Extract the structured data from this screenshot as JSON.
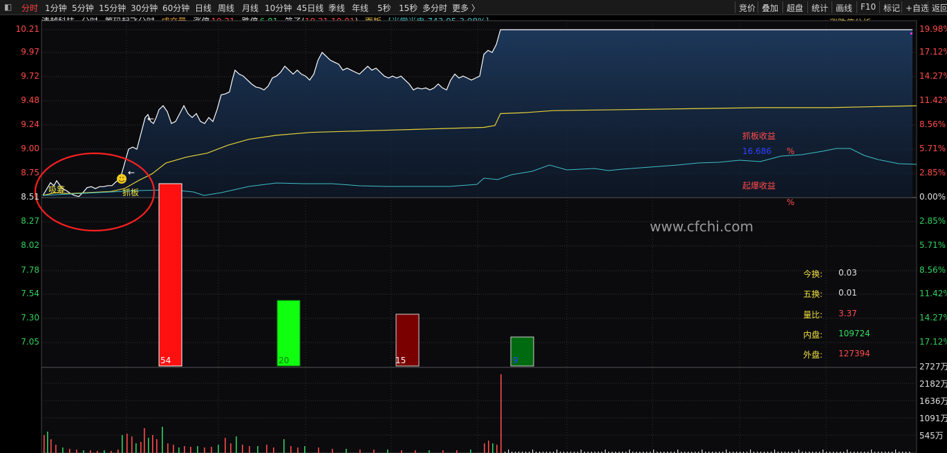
{
  "topbar": {
    "tabs": [
      "分时",
      "1分钟",
      "5分钟",
      "15分钟",
      "30分钟",
      "60分钟",
      "日线",
      "周线",
      "月线",
      "10分钟",
      "45日线",
      "季线",
      "年线",
      "5秒",
      "15秒",
      "多分时",
      "更多 〉"
    ],
    "active_tab": 0,
    "right_buttons": [
      "竞价",
      "叠加",
      "超盘",
      "统计",
      "画线",
      "F10",
      "标记",
      "+自选",
      "返回"
    ]
  },
  "info": {
    "name": "清越科技",
    "mode": "分时",
    "indicator": "筹码起飞分时",
    "volume_label": "成交量",
    "limit_up_label": "涨停",
    "limit_up_value": "10.21",
    "limit_down_label": "跌停",
    "limit_down_value": "6.81",
    "cage_label": "笼子(",
    "cage_value": "10.21 10.01",
    "cage_close": ")",
    "panel_label": "面板",
    "sector": "[光学光电",
    "sector_value": "743.95",
    "sector_pct": "3.98%]",
    "analysis_btn": "涨跌停分析"
  },
  "axis": {
    "prices": [
      "10.21",
      "9.97",
      "9.72",
      "9.48",
      "9.24",
      "9.00",
      "8.75",
      "8.51",
      "8.27",
      "8.02",
      "7.78",
      "7.54",
      "7.30",
      "7.05"
    ],
    "percents": [
      "19.98%",
      "17.12%",
      "14.27%",
      "11.42%",
      "8.56%",
      "5.71%",
      "2.85%",
      "0.00%",
      "2.85%",
      "5.71%",
      "8.56%",
      "11.42%",
      "14.27%",
      "17.12%"
    ],
    "volumes": [
      "2727万",
      "2182万",
      "1636万",
      "1091万",
      "545万"
    ]
  },
  "annotations": {
    "xishou": "吸筹",
    "zhuaban": "抓板",
    "zhuaban_profit_label": "抓板收益",
    "zhuaban_profit_value": "16.686",
    "pct_sign": "%",
    "qibao_label": "起爆收益",
    "watermark": "www.cfchi.com",
    "bar_labels": [
      "54",
      "20",
      "15",
      "9"
    ]
  },
  "stats": [
    {
      "label": "今换:",
      "value": "0.03",
      "color": "#e0e0e0"
    },
    {
      "label": "五换:",
      "value": "0.01",
      "color": "#e0e0e0"
    },
    {
      "label": "量比:",
      "value": "3.37",
      "color": "#ff4b4b"
    },
    {
      "label": "内盘:",
      "value": "109724",
      "color": "#30e060"
    },
    {
      "label": "外盘:",
      "value": "127394",
      "color": "#ff4b4b"
    }
  ],
  "colors": {
    "up": "#ff4b4b",
    "down": "#30d060",
    "avg": "#e6d23a",
    "cyan": "#3fc0c8"
  }
}
